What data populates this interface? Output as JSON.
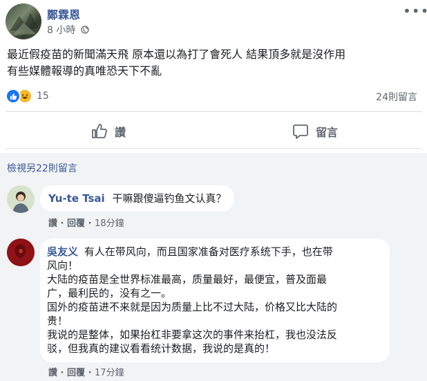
{
  "post": {
    "author": "鄭霖恩",
    "time": "8 小時",
    "text_line1": "最近假疫苗的新聞滿天飛 原本還以為打了會死人 結果頂多就是沒作用",
    "text_line2": "有些媒體報導的真唯恐天下不亂",
    "reaction_count": "15",
    "comment_count": "24則留言",
    "reaction_icons": [
      "like-icon",
      "haha-icon"
    ],
    "like_label": "讚",
    "comment_label": "留言"
  },
  "comments_section": {
    "view_more": "檢視另22則留言",
    "comments": [
      {
        "name": "Yu-te Tsai",
        "text": "干嘛跟傻逼钓鱼文认真？",
        "like": "讚",
        "reply": "回覆",
        "time": "18分鐘"
      },
      {
        "name": "吳友义",
        "lines": [
          "有人在带风向，而且国家准备对医疗系统下手，也在带",
          "风向！",
          "大陆的疫苗是全世界标准最高，质量最好，最便宜，普及面最",
          "广，最利民的，没有之一。",
          "国外的疫苗进不来就是因为质量上比不过大陆，价格又比大陆的",
          "贵！",
          "我说的是整体，如果抬杠非要拿这次的事件来抬杠，我也没法反",
          "驳，但我真的建议看看统计数据，我说的是真的！"
        ],
        "like": "讚",
        "reply": "回覆",
        "time": "17分鐘"
      }
    ]
  },
  "colors": {
    "link": "#385898",
    "like_blue": "#1877f2",
    "haha_yellow": "#f7b928",
    "muted": "#606770"
  }
}
